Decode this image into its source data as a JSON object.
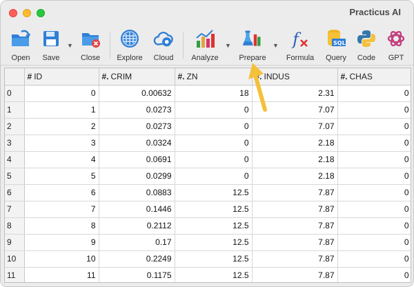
{
  "window": {
    "title": "Practicus AI"
  },
  "colors": {
    "accent": "#f5c03a",
    "toolbar_bg": "#ececec"
  },
  "toolbar": {
    "items": [
      {
        "label": "Open",
        "icon": "folder-open-icon"
      },
      {
        "label": "Save",
        "icon": "save-icon"
      },
      {
        "label": "Close",
        "icon": "close-folder-icon"
      },
      {
        "label": "Explore",
        "icon": "explore-globe-icon"
      },
      {
        "label": "Cloud",
        "icon": "cloud-gear-icon"
      },
      {
        "label": "Analyze",
        "icon": "analyze-chart-icon"
      },
      {
        "label": "Prepare",
        "icon": "prepare-flask-icon"
      },
      {
        "label": "Formula",
        "icon": "formula-fx-icon"
      },
      {
        "label": "Query",
        "icon": "sql-query-icon"
      },
      {
        "label": "Code",
        "icon": "python-code-icon"
      },
      {
        "label": "GPT",
        "icon": "gpt-icon"
      }
    ]
  },
  "table": {
    "columns": [
      {
        "type": "#",
        "name": "ID"
      },
      {
        "type": "#.",
        "name": "CRIM"
      },
      {
        "type": "#.",
        "name": "ZN"
      },
      {
        "type": "#.",
        "name": "INDUS"
      },
      {
        "type": "#.",
        "name": "CHAS"
      }
    ],
    "rows": [
      {
        "index": "0",
        "cells": [
          "0",
          "0.00632",
          "18",
          "2.31",
          "0"
        ]
      },
      {
        "index": "1",
        "cells": [
          "1",
          "0.0273",
          "0",
          "7.07",
          "0"
        ]
      },
      {
        "index": "2",
        "cells": [
          "2",
          "0.0273",
          "0",
          "7.07",
          "0"
        ]
      },
      {
        "index": "3",
        "cells": [
          "3",
          "0.0324",
          "0",
          "2.18",
          "0"
        ]
      },
      {
        "index": "4",
        "cells": [
          "4",
          "0.0691",
          "0",
          "2.18",
          "0"
        ]
      },
      {
        "index": "5",
        "cells": [
          "5",
          "0.0299",
          "0",
          "2.18",
          "0"
        ]
      },
      {
        "index": "6",
        "cells": [
          "6",
          "0.0883",
          "12.5",
          "7.87",
          "0"
        ]
      },
      {
        "index": "7",
        "cells": [
          "7",
          "0.1446",
          "12.5",
          "7.87",
          "0"
        ]
      },
      {
        "index": "8",
        "cells": [
          "8",
          "0.2112",
          "12.5",
          "7.87",
          "0"
        ]
      },
      {
        "index": "9",
        "cells": [
          "9",
          "0.17",
          "12.5",
          "7.87",
          "0"
        ]
      },
      {
        "index": "10",
        "cells": [
          "10",
          "0.2249",
          "12.5",
          "7.87",
          "0"
        ]
      },
      {
        "index": "11",
        "cells": [
          "11",
          "0.1175",
          "12.5",
          "7.87",
          "0"
        ]
      }
    ]
  }
}
